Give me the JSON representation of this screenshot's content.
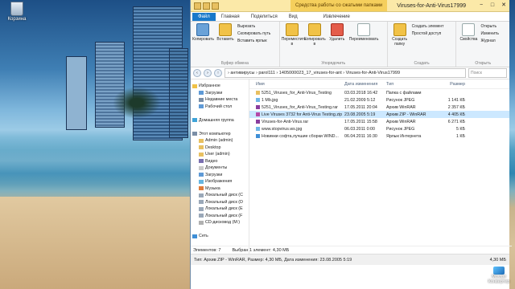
{
  "desktop": {
    "recycle_bin_label": "Корзина",
    "watermark": "Movavi Конвертер"
  },
  "window": {
    "context_tab": "Средства работы со сжатыми папками",
    "title": "Viruses-for-Anti-Virus17999",
    "buttons": [
      "−",
      "□",
      "✕"
    ]
  },
  "tabs": [
    "Файл",
    "Главная",
    "Поделиться",
    "Вид",
    "Извлечение"
  ],
  "ribbon": {
    "clipboard": {
      "copy": "Копировать",
      "paste": "Вставить",
      "cut": "Вырезать",
      "copy_path": "Скопировать путь",
      "paste_shortcut": "Вставить ярлык",
      "label": "Буфер обмена"
    },
    "organize": {
      "move": "Переместить в",
      "copy_to": "Копировать в",
      "delete": "Удалить",
      "rename": "Переименовать",
      "label": "Упорядочить"
    },
    "new": {
      "new_folder": "Создать папку",
      "new_item": "Создать элемент",
      "easy_access": "Простой доступ",
      "label": "Создать"
    },
    "open": {
      "properties": "Свойства",
      "open": "Открыть",
      "edit": "Изменить",
      "history": "Журнал",
      "label": "Открыть"
    }
  },
  "address": {
    "path": "›  антивирусы  ›  parol111  ›  1405000023_17_viruses-for-ant  ›  Viruses-for-Anti-Virus17999",
    "search_placeholder": "Поиск"
  },
  "navpane": [
    {
      "label": "Избранное",
      "icon": "star-icon"
    },
    {
      "label": "Загрузки",
      "icon": "download-folder-icon"
    },
    {
      "label": "Недавние места",
      "icon": "recent-icon"
    },
    {
      "label": "Рабочий стол",
      "icon": "desktop-icon"
    },
    {
      "label": "",
      "icon": ""
    },
    {
      "label": "Домашняя группа",
      "icon": "homegroup-icon"
    },
    {
      "label": "",
      "icon": ""
    },
    {
      "label": "Этот компьютер",
      "icon": "computer-icon"
    },
    {
      "label": "Admin (admin)",
      "icon": "folder-icon"
    },
    {
      "label": "Desktop",
      "icon": "folder-icon"
    },
    {
      "label": "User (admin)",
      "icon": "folder-icon"
    },
    {
      "label": "Видео",
      "icon": "video-icon"
    },
    {
      "label": "Документы",
      "icon": "documents-icon"
    },
    {
      "label": "Загрузки",
      "icon": "download-folder-icon"
    },
    {
      "label": "Изображения",
      "icon": "pictures-icon"
    },
    {
      "label": "Музыка",
      "icon": "music-icon"
    },
    {
      "label": "Локальный диск (C",
      "icon": "drive-icon"
    },
    {
      "label": "Локальный диск (D",
      "icon": "drive-icon"
    },
    {
      "label": "Локальный диск (E",
      "icon": "drive-icon"
    },
    {
      "label": "Локальный диск (F",
      "icon": "drive-icon"
    },
    {
      "label": "CD-дисковод (M:)",
      "icon": "cd-drive-icon"
    },
    {
      "label": "",
      "icon": ""
    },
    {
      "label": "Сеть",
      "icon": "network-icon"
    }
  ],
  "columns": {
    "name": "Имя",
    "date": "Дата изменения",
    "type": "Тип",
    "size": "Размер"
  },
  "files": [
    {
      "name": "5251_Viruses_for_Anti-Virus_Testing",
      "date": "03.03.2018 16:42",
      "type": "Папка с файлами",
      "size": "",
      "icon": "folder-icon",
      "selected": false
    },
    {
      "name": "1 Mb.jpg",
      "date": "21.02.2009 5:12",
      "type": "Рисунок JPEG",
      "size": "1 141 КБ",
      "icon": "image-icon",
      "selected": false
    },
    {
      "name": "5251_Viruses_for_Anti-Virus_Testing.rar",
      "date": "17.05.2011 20:04",
      "type": "Архив WinRAR",
      "size": "2 357 КБ",
      "icon": "archive-icon",
      "selected": false
    },
    {
      "name": "Live Viruses 3732 for Anti-Virus Testing.zip",
      "date": "23.08.2005 5:19",
      "type": "Архив ZIP - WinRAR",
      "size": "4 405 КБ",
      "icon": "zip-icon",
      "selected": true
    },
    {
      "name": "Viruses-for-Anti-Virus.rar",
      "date": "17.05.2011 15:58",
      "type": "Архив WinRAR",
      "size": "6 271 КБ",
      "icon": "archive-icon",
      "selected": false
    },
    {
      "name": "www.stopvirus.ws.jpg",
      "date": "06.03.2011 0:00",
      "type": "Рисунок JPEG",
      "size": "5 КБ",
      "icon": "image-icon",
      "selected": false
    },
    {
      "name": "Новинки софта,лучшие сборки WIND...",
      "date": "06.04.2011 16:30",
      "type": "Ярлык Интернета",
      "size": "1 КБ",
      "icon": "internet-shortcut-icon",
      "selected": false
    }
  ],
  "status": {
    "count": "Элементов: 7",
    "selected": "Выбран 1 элемент: 4,30 МБ"
  },
  "info": {
    "details": "Тип: Архив ZIP - WinRAR, Размер: 4,30 МБ, Дата изменения: 23.08.2005 5:19",
    "size": "4,30 МБ"
  }
}
